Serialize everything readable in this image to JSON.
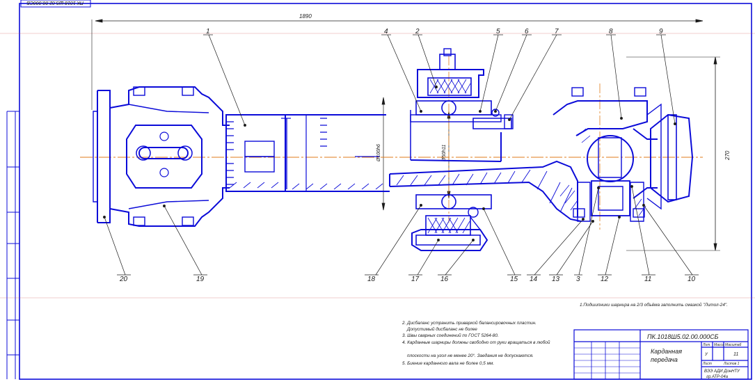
{
  "drawing": {
    "top_code": "ПК 1018 Ш5.02.00.000СБ",
    "overall_length": "1890",
    "overall_height": "270",
    "dia_left": "Ø100h6",
    "dia_right": "Ø50h11"
  },
  "callouts_top": [
    "1",
    "4",
    "2",
    "5",
    "6",
    "7",
    "8",
    "9"
  ],
  "callouts_bottom": [
    "20",
    "19",
    "18",
    "17",
    "16",
    "15",
    "14",
    "13",
    "3",
    "12",
    "11",
    "10"
  ],
  "notes": {
    "note1": "1.Подшипники шарнира на 2/3 объёма заполнить смазкой \"Литол-24\".",
    "note2a": "2. Дисбаланс устранить приваркой балансировочных пластин.",
    "note2b": "Допустимый дисбаланс не более",
    "note3": "3. Швы сварных соединений по ГОСТ 5264-80.",
    "note4a": "4. Карданные шарниры должны свободно от руки вращаться в любой",
    "note4b": "плоскости на угол не менее 20°. Заедания не допускаются.",
    "note5": "5. Биение карданного вала не более 0,5 мм."
  },
  "title_block": {
    "code": "ПК.1018Ш5.02.00.000СБ",
    "name_line1": "Карданная",
    "name_line2": "передача",
    "sheets": "11",
    "org_line1": "ВЭЭ АДИ ДонНТУ",
    "org_line2": "гр.АТР-04а",
    "stage": "У",
    "col_lit": "Лит.",
    "col_mass": "Масса",
    "col_scale": "Масштаб",
    "sheet_label": "Лист",
    "sheets_label": "Листов 1"
  },
  "colors": {
    "part_lines": "#0b0bd8",
    "axis": "#e07a1a",
    "frame": "#0b0bd8",
    "text": "#1b1b1b"
  }
}
